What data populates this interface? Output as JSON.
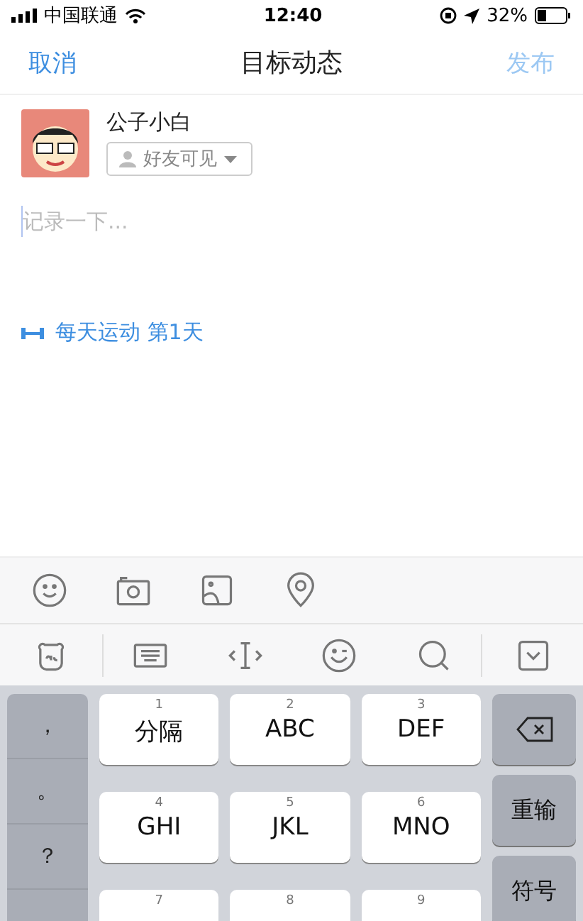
{
  "status_bar": {
    "carrier": "中国联通",
    "time": "12:40",
    "battery": "32%"
  },
  "nav": {
    "cancel": "取消",
    "title": "目标动态",
    "publish": "发布",
    "publish_disabled": true
  },
  "author": {
    "name": "公子小白",
    "visibility": "好友可见"
  },
  "editor": {
    "placeholder": "记录一下..."
  },
  "goal_tag": {
    "label": "每天运动 第1天"
  },
  "keyboard": {
    "punctuation": [
      "，",
      "。",
      "？"
    ],
    "keys": [
      {
        "number": "1",
        "label": "分隔"
      },
      {
        "number": "2",
        "label": "ABC"
      },
      {
        "number": "3",
        "label": "DEF"
      },
      {
        "number": "4",
        "label": "GHI"
      },
      {
        "number": "5",
        "label": "JKL"
      },
      {
        "number": "6",
        "label": "MNO"
      },
      {
        "number": "7"
      },
      {
        "number": "8"
      },
      {
        "number": "9"
      }
    ],
    "side_keys": [
      {
        "kind": "backspace"
      },
      {
        "kind": "text",
        "label": "重输"
      },
      {
        "kind": "text",
        "label": "符号"
      }
    ]
  }
}
